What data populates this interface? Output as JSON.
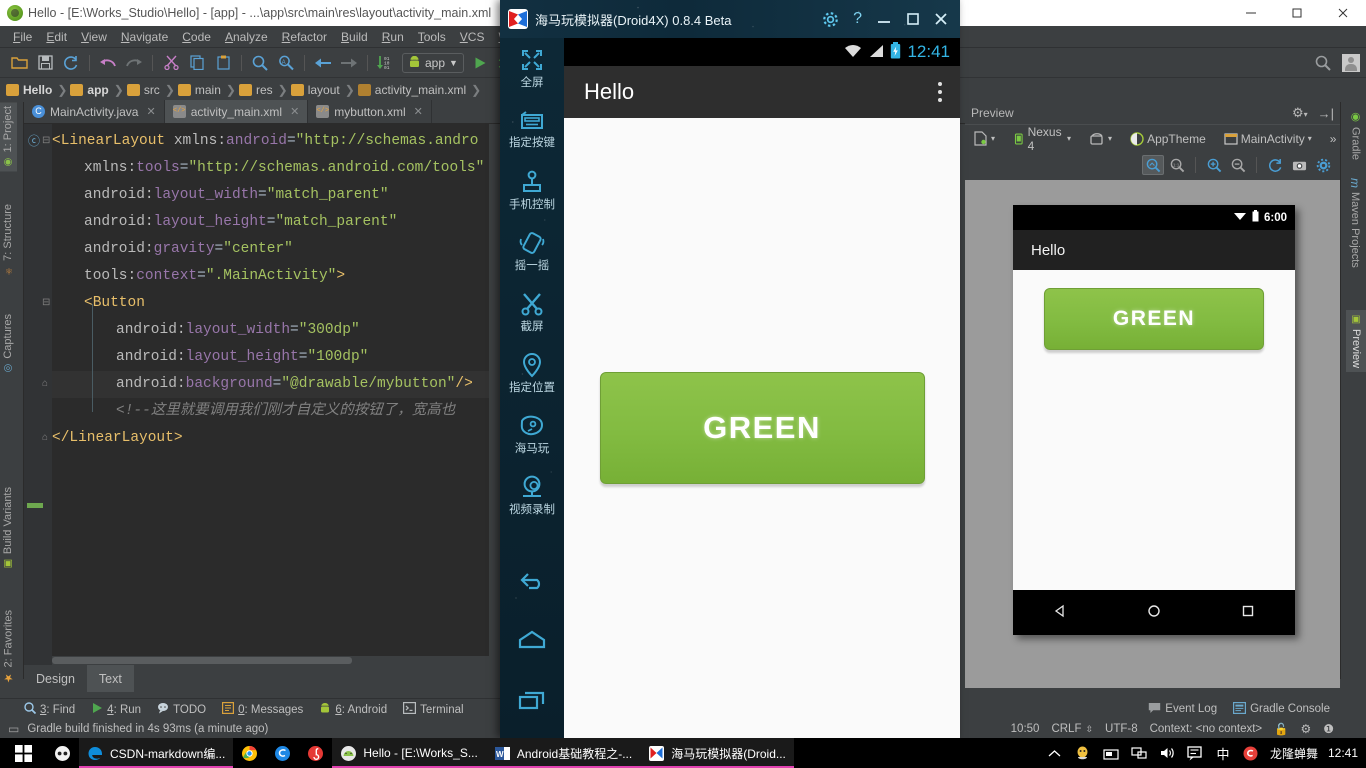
{
  "ide": {
    "title": "Hello - [E:\\Works_Studio\\Hello] - [app] - ...\\app\\src\\main\\res\\layout\\activity_main.xml",
    "menu": [
      "File",
      "Edit",
      "View",
      "Navigate",
      "Code",
      "Analyze",
      "Refactor",
      "Build",
      "Run",
      "Tools",
      "VCS",
      "W"
    ],
    "run_config": "app",
    "breadcrumb": [
      "Hello",
      "app",
      "src",
      "main",
      "res",
      "layout",
      "activity_main.xml"
    ],
    "editor_tabs": [
      {
        "label": "MainActivity.java",
        "icon": "java-class-icon",
        "active": false
      },
      {
        "label": "activity_main.xml",
        "icon": "xml-file-icon",
        "active": true
      },
      {
        "label": "mybutton.xml",
        "icon": "xml-file-icon",
        "active": false
      }
    ],
    "left_tool_tabs": [
      "1: Project",
      "7: Structure",
      "Captures",
      "Build Variants",
      "2: Favorites"
    ],
    "right_tool_tabs": [
      "Gradle",
      "Maven Projects",
      "Preview"
    ],
    "code_lines": [
      {
        "indent": 0,
        "parts": [
          {
            "t": "tag",
            "v": "<LinearLayout"
          },
          {
            "t": "plain",
            "v": " "
          },
          {
            "t": "attr",
            "v": "xmlns:"
          },
          {
            "t": "ns",
            "v": "android"
          },
          {
            "t": "eq",
            "v": "="
          },
          {
            "t": "str",
            "v": "\"http://schemas.andro"
          }
        ]
      },
      {
        "indent": 1,
        "parts": [
          {
            "t": "attr",
            "v": "xmlns:"
          },
          {
            "t": "ns",
            "v": "tools"
          },
          {
            "t": "eq",
            "v": "="
          },
          {
            "t": "str",
            "v": "\"http://schemas.android.com/tools\""
          }
        ]
      },
      {
        "indent": 1,
        "parts": [
          {
            "t": "attr",
            "v": "android:"
          },
          {
            "t": "ns",
            "v": "layout_width"
          },
          {
            "t": "eq",
            "v": "="
          },
          {
            "t": "str",
            "v": "\"match_parent\""
          }
        ]
      },
      {
        "indent": 1,
        "parts": [
          {
            "t": "attr",
            "v": "android:"
          },
          {
            "t": "ns",
            "v": "layout_height"
          },
          {
            "t": "eq",
            "v": "="
          },
          {
            "t": "str",
            "v": "\"match_parent\""
          }
        ]
      },
      {
        "indent": 1,
        "parts": [
          {
            "t": "attr",
            "v": "android:"
          },
          {
            "t": "ns",
            "v": "gravity"
          },
          {
            "t": "eq",
            "v": "="
          },
          {
            "t": "str",
            "v": "\"center\""
          }
        ]
      },
      {
        "indent": 1,
        "parts": [
          {
            "t": "attr",
            "v": "tools:"
          },
          {
            "t": "ns",
            "v": "context"
          },
          {
            "t": "eq",
            "v": "="
          },
          {
            "t": "str",
            "v": "\".MainActivity\""
          },
          {
            "t": "tag",
            "v": ">"
          }
        ]
      },
      {
        "indent": 1,
        "parts": [
          {
            "t": "tag",
            "v": "<Button"
          }
        ]
      },
      {
        "indent": 2,
        "parts": [
          {
            "t": "attr",
            "v": "android:"
          },
          {
            "t": "ns",
            "v": "layout_width"
          },
          {
            "t": "eq",
            "v": "="
          },
          {
            "t": "str",
            "v": "\"300dp\""
          }
        ]
      },
      {
        "indent": 2,
        "parts": [
          {
            "t": "attr",
            "v": "android:"
          },
          {
            "t": "ns",
            "v": "layout_height"
          },
          {
            "t": "eq",
            "v": "="
          },
          {
            "t": "str",
            "v": "\"100dp\""
          }
        ]
      },
      {
        "indent": 2,
        "parts": [
          {
            "t": "attr",
            "v": "android:"
          },
          {
            "t": "ns",
            "v": "background"
          },
          {
            "t": "eq",
            "v": "="
          },
          {
            "t": "str",
            "v": "\"@drawable/mybutton\""
          },
          {
            "t": "tag",
            "v": "/>"
          }
        ]
      },
      {
        "indent": 2,
        "parts": [
          {
            "t": "cmt",
            "v": "<!--这里就要调用我们刚才自定义的按钮了，宽高也"
          }
        ]
      },
      {
        "indent": 0,
        "parts": [
          {
            "t": "tag",
            "v": "</LinearLayout>"
          }
        ]
      }
    ],
    "design_text_tabs": [
      {
        "label": "Design",
        "active": false
      },
      {
        "label": "Text",
        "active": true
      }
    ],
    "bottom_tool_windows": [
      {
        "num": "3",
        "label": ": Find",
        "icon": "magnifier-icon"
      },
      {
        "num": "4",
        "label": ": Run",
        "icon": "play-icon"
      },
      {
        "num": "",
        "label": "TODO",
        "icon": "todo-icon"
      },
      {
        "num": "0",
        "label": ": Messages",
        "icon": "messages-icon"
      },
      {
        "num": "6",
        "label": ": Android",
        "icon": "android-icon"
      },
      {
        "num": "",
        "label": "Terminal",
        "icon": "terminal-icon"
      }
    ],
    "right_tool_windows": [
      {
        "label": "Event Log",
        "icon": "speech-bubble-icon"
      },
      {
        "label": "Gradle Console",
        "icon": "console-icon"
      }
    ],
    "status_message": "Gradle build finished in 4s 93ms (a minute ago)",
    "status_right": [
      "10:50",
      "CRLF",
      "UTF-8",
      "Context: <no context>"
    ]
  },
  "preview": {
    "title": "Preview",
    "device": "Nexus 4",
    "theme": "AppTheme",
    "activity": "MainActivity",
    "overflow": "»",
    "zoom_buttons": [
      "zoom-to-fit-icon",
      "zoom-actual-icon",
      "zoom-in-icon",
      "zoom-out-icon",
      "refresh-icon",
      "screenshot-icon",
      "settings-icon"
    ],
    "screen": {
      "statusbar_time": "6:00",
      "app_title": "Hello",
      "button_label": "GREEN",
      "nav": [
        "back-triangle-icon",
        "home-circle-icon",
        "recents-square-icon"
      ]
    }
  },
  "emulator": {
    "title": "海马玩模拟器(Droid4X) 0.8.4 Beta",
    "window_controls": [
      "settings-gear-icon",
      "help-question-icon",
      "minimize-icon",
      "maximize-icon",
      "close-icon"
    ],
    "sidebar": [
      {
        "label": "全屏",
        "icon": "fullscreen-icon"
      },
      {
        "label": "指定按键",
        "icon": "keyboard-mapping-icon"
      },
      {
        "label": "手机控制",
        "icon": "gamepad-icon"
      },
      {
        "label": "摇一摇",
        "icon": "shake-icon"
      },
      {
        "label": "截屏",
        "icon": "scissors-icon"
      },
      {
        "label": "指定位置",
        "icon": "location-pin-icon"
      },
      {
        "label": "海马玩",
        "icon": "droid4x-store-icon"
      },
      {
        "label": "视频录制",
        "icon": "video-record-icon"
      }
    ],
    "nav": [
      {
        "icon": "back-arrow-icon"
      },
      {
        "icon": "home-icon"
      },
      {
        "icon": "recents-icon"
      }
    ],
    "screen": {
      "statusbar_time": "12:41",
      "statusbar_icons": [
        "wifi-icon",
        "signal-icon",
        "battery-charging-icon"
      ],
      "app_title": "Hello",
      "overflow_icon": "overflow-menu-icon",
      "button_label": "GREEN"
    }
  },
  "taskbar": {
    "items": [
      {
        "label": "",
        "icon": "cortana-icon",
        "open": false
      },
      {
        "label": "CSDN-markdown编...",
        "icon": "edge-icon",
        "open": true
      },
      {
        "label": "",
        "icon": "chrome-icon",
        "open": false
      },
      {
        "label": "",
        "icon": "sogou-icon",
        "open": false
      },
      {
        "label": "",
        "icon": "netease-music-icon",
        "open": false
      },
      {
        "label": "Hello - [E:\\Works_S...",
        "icon": "android-studio-icon",
        "open": true
      },
      {
        "label": "Android基础教程之-...",
        "icon": "word-icon",
        "open": true
      },
      {
        "label": "海马玩模拟器(Droid...",
        "icon": "droid4x-icon",
        "open": true
      }
    ],
    "tray": [
      "chevron-up-icon",
      "qq-icon",
      "screenshot-tray-icon",
      "network-icon",
      "volume-icon",
      "ime-panel-icon",
      "ime-chinese-icon",
      "sogou-tray-icon"
    ],
    "tray_user": "龙隆蝉舞",
    "clock": "12:41"
  },
  "colors": {
    "accent_green": "#8ec34a",
    "ide_bg": "#3c3f41",
    "editor_bg": "#2b2b2b",
    "emulator_bg": "#0d2836",
    "emulator_accent": "#33b5e5"
  }
}
